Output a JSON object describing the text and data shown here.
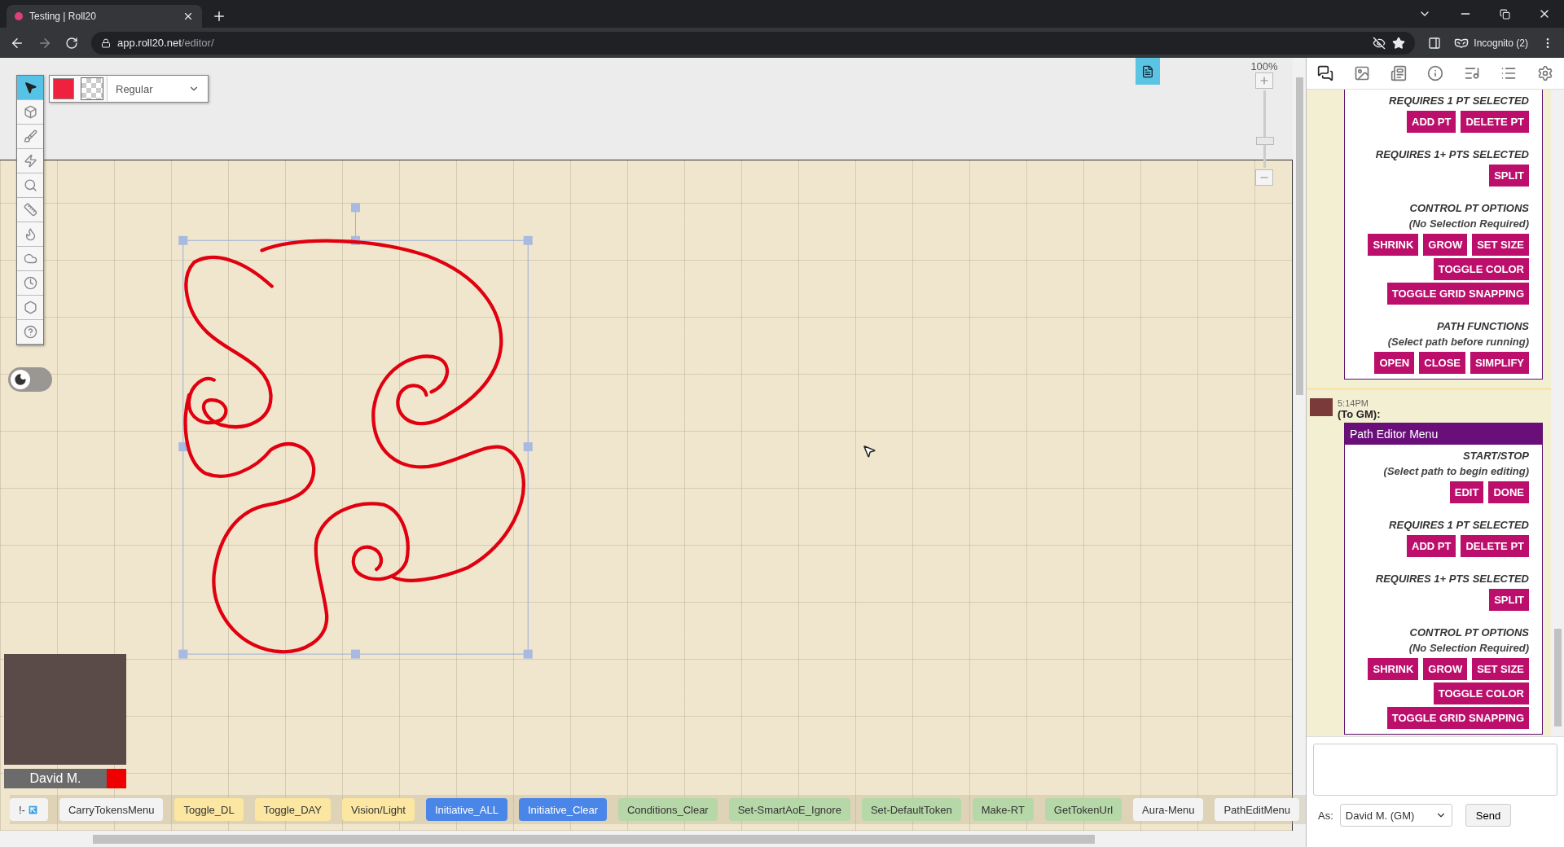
{
  "browser": {
    "tab_title": "Testing | Roll20",
    "url_host": "app.roll20.net",
    "url_path": "/editor/",
    "profile": "Incognito (2)"
  },
  "tools": [
    {
      "kind": "select",
      "selected": true
    },
    {
      "kind": "layers",
      "selected": false
    },
    {
      "kind": "draw",
      "selected": false
    },
    {
      "kind": "fx",
      "selected": false
    },
    {
      "kind": "zoom",
      "selected": false
    },
    {
      "kind": "measure",
      "selected": false
    },
    {
      "kind": "light",
      "selected": false
    },
    {
      "kind": "fog",
      "selected": false
    },
    {
      "kind": "turn",
      "selected": false
    },
    {
      "kind": "dice",
      "selected": false
    },
    {
      "kind": "help",
      "selected": false
    }
  ],
  "style_bar": {
    "line_type": "Regular"
  },
  "zoom": {
    "label": "100%",
    "level": 0.35
  },
  "dark_mode": {
    "on": false
  },
  "video": {
    "name": "David M.",
    "color": "#ee0000"
  },
  "macros": [
    {
      "label": "!-",
      "kind": "icon",
      "color": "#f3f3f3"
    },
    {
      "label": "CarryTokensMenu",
      "kind": "plain",
      "color": "#f3f3f3"
    },
    {
      "label": "Toggle_DL",
      "kind": "plain",
      "color": "#fbe7a1"
    },
    {
      "label": "Toggle_DAY",
      "kind": "plain",
      "color": "#fbe7a1"
    },
    {
      "label": "Vision/Light",
      "kind": "plain",
      "color": "#fbe7a1"
    },
    {
      "label": "Initiative_ALL",
      "kind": "plain",
      "color": "#4a86e8"
    },
    {
      "label": "Initiative_Clear",
      "kind": "plain",
      "color": "#4a86e8"
    },
    {
      "label": "Conditions_Clear",
      "kind": "plain",
      "color": "#b6d7a8"
    },
    {
      "label": "Set-SmartAoE_Ignore",
      "kind": "plain",
      "color": "#b6d7a8"
    },
    {
      "label": "Set-DefaultToken",
      "kind": "plain",
      "color": "#b6d7a8"
    },
    {
      "label": "Make-RT",
      "kind": "plain",
      "color": "#b6d7a8"
    },
    {
      "label": "GetTokenUrl",
      "kind": "plain",
      "color": "#b6d7a8"
    },
    {
      "label": "Aura-Menu",
      "kind": "plain",
      "color": "#f3f3f3"
    },
    {
      "label": "PathEditMenu",
      "kind": "plain",
      "color": "#f3f3f3"
    }
  ],
  "chat": {
    "tabs": [
      {
        "kind": "chat",
        "selected": true
      },
      {
        "kind": "art",
        "selected": false
      },
      {
        "kind": "journal",
        "selected": false
      },
      {
        "kind": "info",
        "selected": false
      },
      {
        "kind": "jukebox",
        "selected": false
      },
      {
        "kind": "collection",
        "selected": false
      },
      {
        "kind": "settings",
        "selected": false
      }
    ],
    "messages": [
      {
        "kind": "partial",
        "sections": [
          {
            "heading": "REQUIRES 1 PT SELECTED",
            "rows": [
              [
                "ADD PT",
                "DELETE PT"
              ]
            ]
          },
          {
            "heading": "REQUIRES 1+ PTS SELECTED",
            "rows": [
              [
                "SPLIT"
              ]
            ]
          },
          {
            "heading": "CONTROL PT OPTIONS",
            "note": "(No Selection Required)",
            "rows": [
              [
                "SHRINK",
                "GROW",
                "SET SIZE"
              ],
              [
                "TOGGLE COLOR"
              ],
              [
                "TOGGLE GRID SNAPPING"
              ]
            ]
          },
          {
            "heading": "PATH FUNCTIONS",
            "note": "(Select path before running)",
            "rows": [
              [
                "OPEN",
                "CLOSE",
                "SIMPLIFY"
              ]
            ]
          }
        ]
      },
      {
        "kind": "full",
        "time": "5:14PM",
        "recipient": "(To GM):",
        "title": "Path Editor Menu",
        "sections": [
          {
            "heading": "START/STOP",
            "note": "(Select path to begin editing)",
            "rows": [
              [
                "EDIT",
                "DONE"
              ]
            ]
          },
          {
            "heading": "REQUIRES 1 PT SELECTED",
            "rows": [
              [
                "ADD PT",
                "DELETE PT"
              ]
            ]
          },
          {
            "heading": "REQUIRES 1+ PTS SELECTED",
            "rows": [
              [
                "SPLIT"
              ]
            ]
          },
          {
            "heading": "CONTROL PT OPTIONS",
            "note": "(No Selection Required)",
            "rows": [
              [
                "SHRINK",
                "GROW",
                "SET SIZE"
              ],
              [
                "TOGGLE COLOR"
              ],
              [
                "TOGGLE GRID SNAPPING"
              ]
            ]
          }
        ]
      }
    ],
    "input": {
      "as_label": "As:",
      "as_value": "David M. (GM)",
      "send": "Send"
    }
  }
}
